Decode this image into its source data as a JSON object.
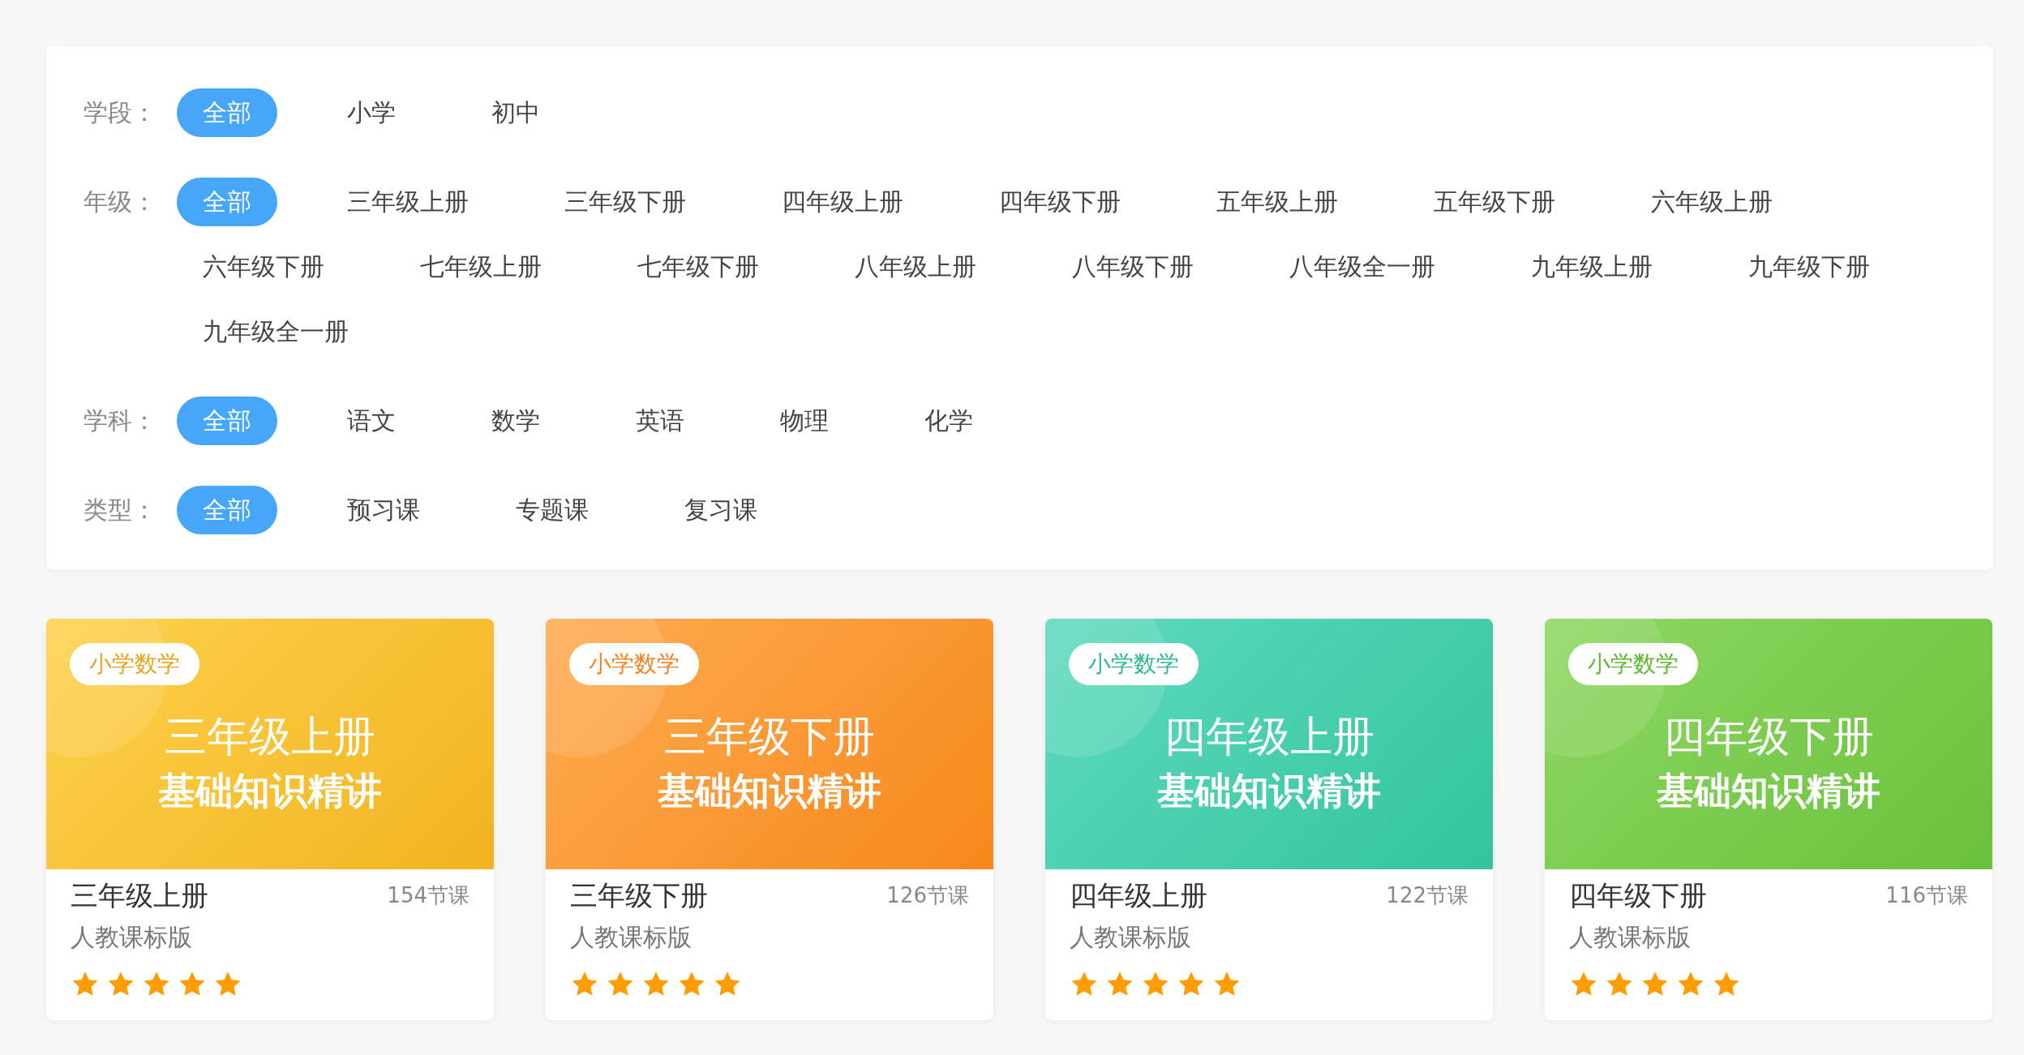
{
  "filters": [
    {
      "label": "学段：",
      "options": [
        {
          "text": "全部",
          "selected": true
        },
        {
          "text": "小学",
          "selected": false
        },
        {
          "text": "初中",
          "selected": false
        }
      ]
    },
    {
      "label": "年级：",
      "options": [
        {
          "text": "全部",
          "selected": true
        },
        {
          "text": "三年级上册",
          "selected": false
        },
        {
          "text": "三年级下册",
          "selected": false
        },
        {
          "text": "四年级上册",
          "selected": false
        },
        {
          "text": "四年级下册",
          "selected": false
        },
        {
          "text": "五年级上册",
          "selected": false
        },
        {
          "text": "五年级下册",
          "selected": false
        },
        {
          "text": "六年级上册",
          "selected": false
        },
        {
          "text": "六年级下册",
          "selected": false
        },
        {
          "text": "七年级上册",
          "selected": false
        },
        {
          "text": "七年级下册",
          "selected": false
        },
        {
          "text": "八年级上册",
          "selected": false
        },
        {
          "text": "八年级下册",
          "selected": false
        },
        {
          "text": "八年级全一册",
          "selected": false
        },
        {
          "text": "九年级上册",
          "selected": false
        },
        {
          "text": "九年级下册",
          "selected": false
        },
        {
          "text": "九年级全一册",
          "selected": false
        }
      ]
    },
    {
      "label": "学科：",
      "options": [
        {
          "text": "全部",
          "selected": true
        },
        {
          "text": "语文",
          "selected": false
        },
        {
          "text": "数学",
          "selected": false
        },
        {
          "text": "英语",
          "selected": false
        },
        {
          "text": "物理",
          "selected": false
        },
        {
          "text": "化学",
          "selected": false
        }
      ]
    },
    {
      "label": "类型：",
      "options": [
        {
          "text": "全部",
          "selected": true
        },
        {
          "text": "预习课",
          "selected": false
        },
        {
          "text": "专题课",
          "selected": false
        },
        {
          "text": "复习课",
          "selected": false
        }
      ]
    }
  ],
  "courses": [
    {
      "tag": "小学数学",
      "color": "#e8a31c",
      "cover_title": "三年级上册",
      "cover_subtitle": "基础知识精讲",
      "title": "三年级上册",
      "count": "154节课",
      "edition": "人教课标版",
      "stars": 5
    },
    {
      "tag": "小学数学",
      "color": "#f5821f",
      "cover_title": "三年级下册",
      "cover_subtitle": "基础知识精讲",
      "title": "三年级下册",
      "count": "126节课",
      "edition": "人教课标版",
      "stars": 5
    },
    {
      "tag": "小学数学",
      "color": "#2db893",
      "cover_title": "四年级上册",
      "cover_subtitle": "基础知识精讲",
      "title": "四年级上册",
      "count": "122节课",
      "edition": "人教课标版",
      "stars": 5
    },
    {
      "tag": "小学数学",
      "color": "#5cb82f",
      "cover_title": "四年级下册",
      "cover_subtitle": "基础知识精讲",
      "title": "四年级下册",
      "count": "116节课",
      "edition": "人教课标版",
      "stars": 5
    }
  ]
}
